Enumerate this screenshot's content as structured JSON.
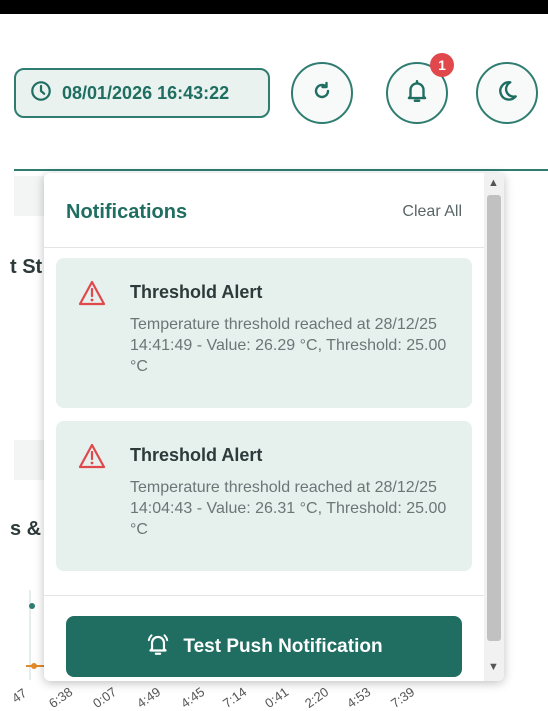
{
  "header": {
    "datetime": "08/01/2026 16:43:22",
    "notification_count": "1",
    "icons": [
      "clock-icon",
      "refresh-icon",
      "bell-icon",
      "moon-icon"
    ]
  },
  "background": {
    "fragment_1": "t St",
    "fragment_2": "s &",
    "ticks": [
      "47",
      "6:38",
      "0:07",
      "4:49",
      "4:45",
      "7:14",
      "0:41",
      "2:20",
      "4:53",
      "7:39"
    ]
  },
  "notifications": {
    "title": "Notifications",
    "clear_all": "Clear All",
    "items": [
      {
        "title": "Threshold Alert",
        "message": "Temperature threshold reached at 28/12/25 14:41:49 - Value: 26.29 °C, Threshold: 25.00 °C"
      },
      {
        "title": "Threshold Alert",
        "message": "Temperature threshold reached at 28/12/25 14:04:43 - Value: 26.31 °C, Threshold: 25.00 °C"
      }
    ],
    "push_button": "Test Push Notification"
  },
  "colors": {
    "accent": "#1f6e61",
    "badge": "#e0484c",
    "warning": "#e0484c",
    "card_bg": "#e6f0ed"
  }
}
